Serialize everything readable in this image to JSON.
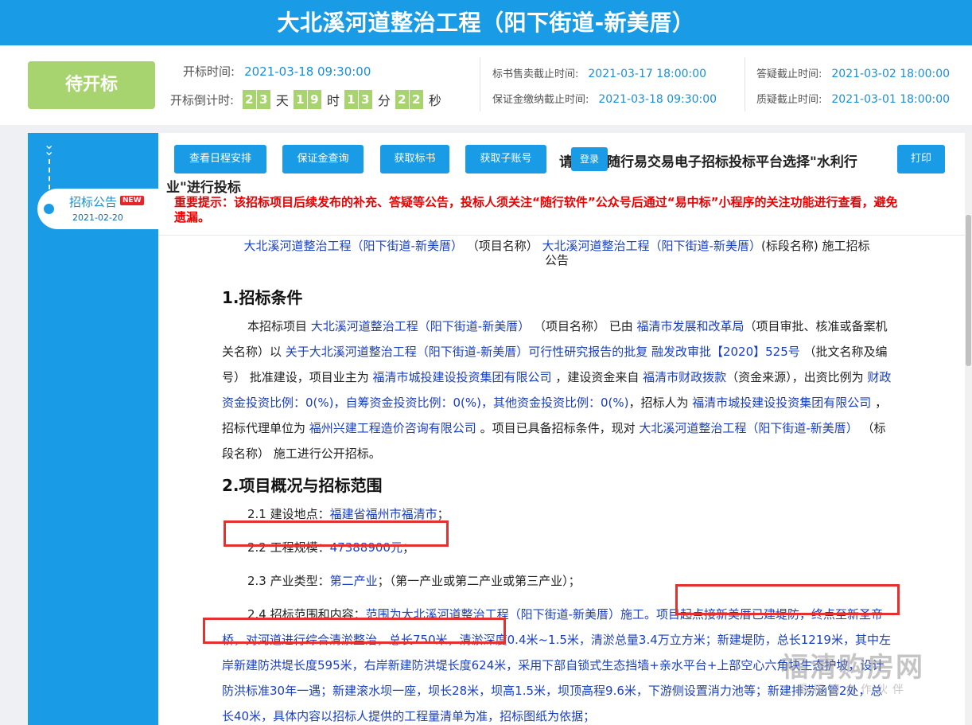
{
  "header": {
    "title": "大北溪河道整治工程（阳下街道-新美厝）"
  },
  "status": {
    "label": "待开标",
    "color": "#a8d46f"
  },
  "bid_open": {
    "time_label": "开标时间:",
    "time_value": "2021-03-18 09:30:00",
    "countdown_label": "开标倒计时:"
  },
  "countdown": {
    "days": [
      "2",
      "3"
    ],
    "day_unit": "天",
    "hours": [
      "1",
      "9"
    ],
    "hour_unit": "时",
    "minutes": [
      "1",
      "3"
    ],
    "minute_unit": "分",
    "seconds": [
      "2",
      "2"
    ],
    "second_unit": "秒"
  },
  "deadlines": {
    "doc_sale_label": "标书售卖截止时间:",
    "doc_sale_value": "2021-03-17 18:00:00",
    "deposit_label": "保证金缴纳截止时间:",
    "deposit_value": "2021-03-18 09:30:00",
    "answer_label": "答疑截止时间:",
    "answer_value": "2021-03-02 18:00:00",
    "query_label": "质疑截止时间:",
    "query_value": "2021-03-01 18:00:00"
  },
  "sidebar": {
    "tab_title": "招标公告",
    "badge": "NEW",
    "tab_date": "2021-02-20"
  },
  "toolbar": {
    "schedule": "查看日程安排",
    "deposit_query": "保证金查询",
    "get_docs": "获取标书",
    "get_account": "获取子账号",
    "print": "打印",
    "login": "登录"
  },
  "notice": {
    "line1_start": "请",
    "line1_end": "随行易交易电子招标投标平台选择\"水利行",
    "line2": "业\"进行投标",
    "tip": "重要提示：该招标项目后续发布的补充、答疑等公告，投标人须关注“随行软件”公众号后通过“易中标”小程序的关注功能进行查看，避免遗漏。"
  },
  "doc": {
    "title_p1": "大北溪河道整治工程（阳下街道-新美厝）",
    "title_p2": "（项目名称）",
    "title_p3": "大北溪河道整治工程（阳下街道-新美厝）",
    "title_p4": "(标段名称) 施工招标",
    "title_p5": "公告",
    "s1_title": "1.招标条件",
    "s1": {
      "t1": "本招标项目 ",
      "b1": "大北溪河道整治工程（阳下街道-新美厝）",
      "t2": " （项目名称） 已由 ",
      "b2": "福清市发展和改革局",
      "t3": "（项目审批、核准或备案机关名称）以 ",
      "b3": "关于大北溪河道整治工程（阳下街道-新美厝）可行性研究报告的批复 融发改审批【2020】525号",
      "t4": " （批文名称及编号） 批准建设，项目业主为 ",
      "b4": "福清市城投建设投资集团有限公司",
      "t5": " ，建设资金来自 ",
      "b5": "福清市财政拨款",
      "t6": "（资金来源），出资比例为 ",
      "b6": "财政资金投资比例：0(%)，自筹资金投资比例：0(%)，其他资金投资比例：0(%)",
      "t7": "，招标人为 ",
      "b7": "福清市城投建设投资集团有限公司",
      "t8": " ，招标代理单位为 ",
      "b8": "福州兴建工程造价咨询有限公司",
      "t9": " 。项目已具备招标条件，现对 ",
      "b9": "大北溪河道整治工程（阳下街道-新美厝）",
      "t10": " （标段名称） 施工进行公开招标。"
    },
    "s2_title": "2.项目概况与招标范围",
    "s2_1_label": "2.1 建设地点：",
    "s2_1_value": "福建省福州市福清市",
    "s2_1_end": "；",
    "s2_2_label": "2.2 工程规模：",
    "s2_2_value": "47388900元",
    "s2_2_end": "；",
    "s2_3_label": "2.3 产业类型：",
    "s2_3_value": "第二产业",
    "s2_3_end": "；（第一产业或第二产业或第三产业）；",
    "s2_4_label": "2.4 招标范围和内容：",
    "s2_4_value": "范围为大北溪河道整治工程（阳下街道-新美厝）施工。项目起点接新美厝已建堤防，终点至新圣帝桥，对河道进行综合清淤整治，总长750米，清淤深度0.4米~1.5米，清淤总量3.4万立方米；新建堤防，总长1219米，其中左岸新建防洪堤长度595米，右岸新建防洪堤长度624米，采用下部自锁式生态挡墙+亲水平台+上部空心六角块生态护坡，设计防洪标准30年一遇；新建滚水坝一座，坝长28米，坝高1.5米，坝顶高程9.6米，下游侧设置消力池等；新建排涝涵管2处，总长40米，具体内容以招标人提供的工程量清单为准，招标图纸为依据；"
  },
  "watermark": {
    "main": "福清购房网",
    "sub": "看福清合作伙伴"
  }
}
